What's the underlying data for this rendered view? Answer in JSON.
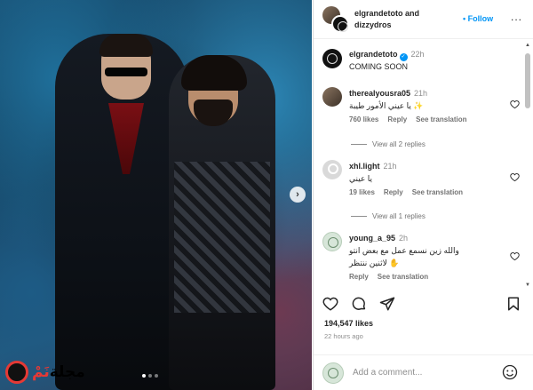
{
  "header": {
    "names_line1": "elgrandetoto and",
    "names_line2": "dizzydros",
    "follow_label": "• Follow",
    "more_label": "..."
  },
  "caption": {
    "username": "elgrandetoto",
    "time": "22h",
    "text": "COMING SOON"
  },
  "comments": [
    {
      "username": "therealyousra05",
      "time": "21h",
      "text": "✨ يا عيني الأمور طيبة",
      "likes": "760 likes",
      "reply": "Reply",
      "see_translation": "See translation",
      "view_replies": "View all 2 replies"
    },
    {
      "username": "xhl.light",
      "time": "21h",
      "text": "يا عيني",
      "likes": "19 likes",
      "reply": "Reply",
      "see_translation": "See translation",
      "view_replies": "View all 1 replies"
    },
    {
      "username": "young_a_95",
      "time": "2h",
      "text": "والله زين نسمع عمل مع بعض انتو",
      "text2": "✋ لاثنين ننتظر",
      "reply": "Reply",
      "see_translation": "See translation"
    }
  ],
  "post": {
    "likes": "194,547 likes",
    "time_ago": "22 hours ago"
  },
  "composer": {
    "placeholder": "Add a comment..."
  },
  "carousel": {
    "next_label": "›",
    "dot_count": 3,
    "active_dot": 0
  },
  "watermark": {
    "text_black": "مجلة",
    "text_red": "نَمْ"
  },
  "colors": {
    "accent_blue": "#0095f6",
    "text_primary": "#262626",
    "text_secondary": "#737373"
  },
  "icons": [
    "more-icon",
    "verified-icon",
    "heart-icon",
    "comment-icon",
    "share-icon",
    "bookmark-icon",
    "emoji-icon",
    "next-arrow-icon"
  ]
}
